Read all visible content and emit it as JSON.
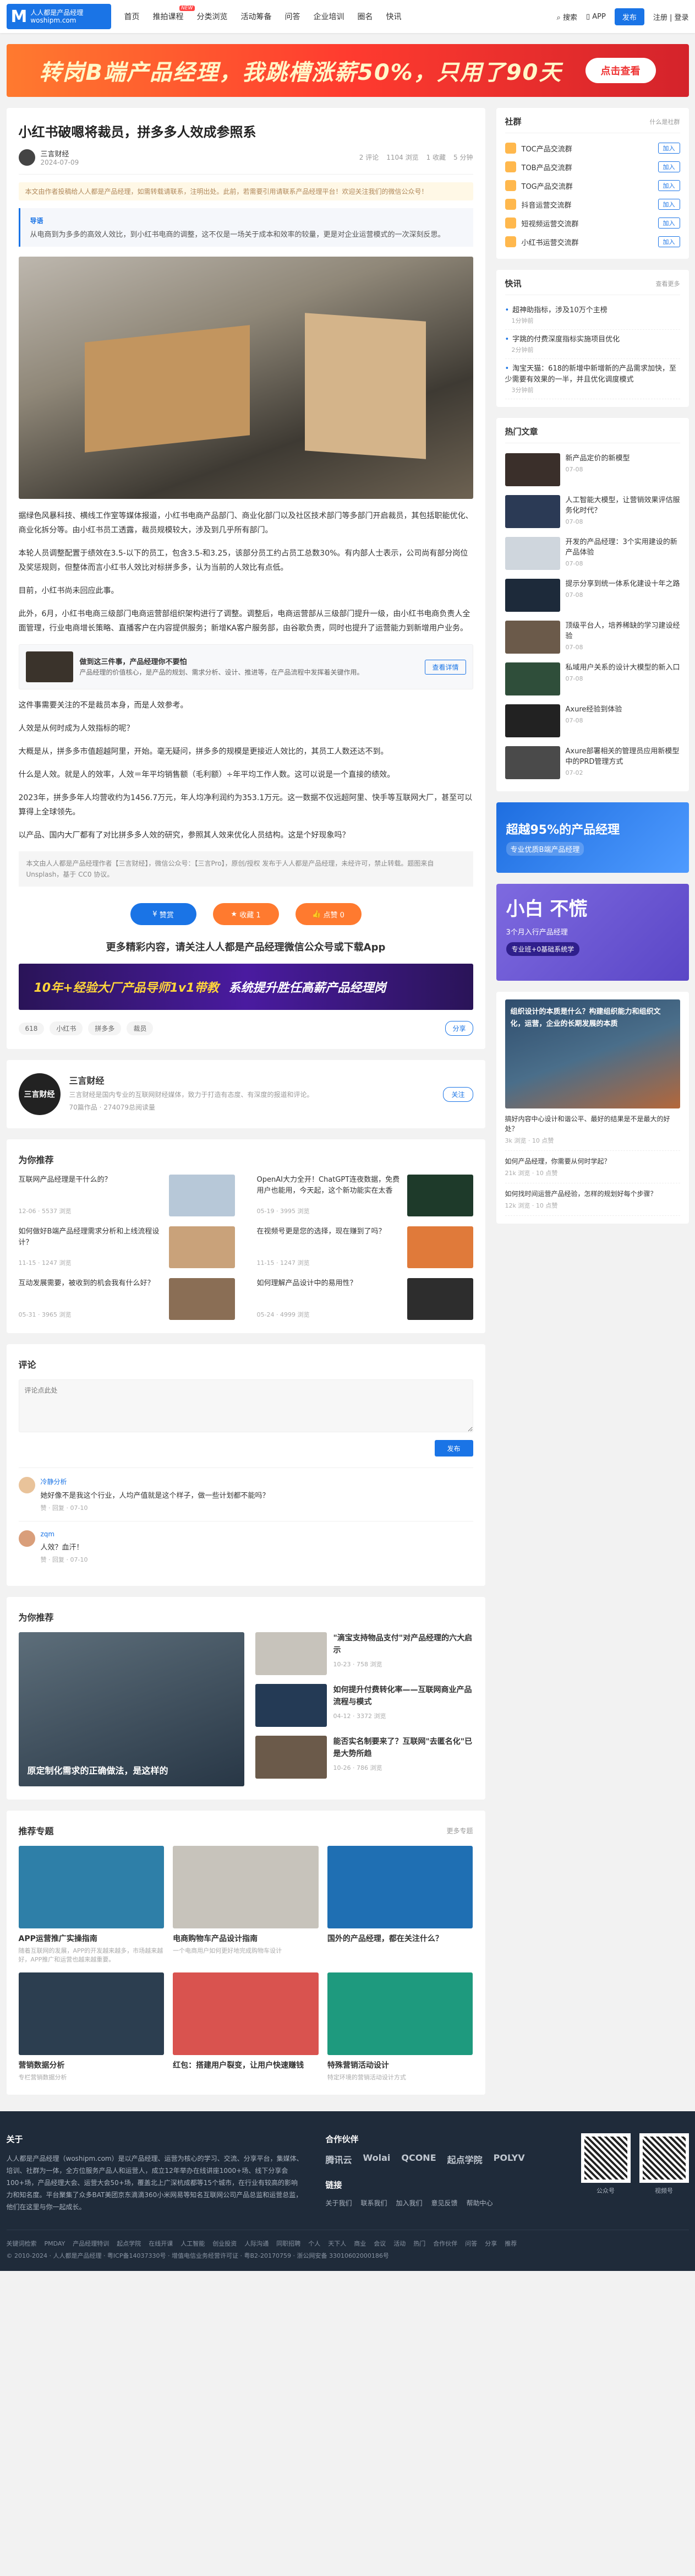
{
  "header": {
    "logo_title": "人人都是产品经理",
    "logo_url": "woshipm.com",
    "nav": [
      "首页",
      "推拍课程",
      "分类浏览",
      "活动筹备",
      "问答",
      "企业培训",
      "圈名",
      "快讯"
    ],
    "new_badge": "NEW",
    "search": "搜索",
    "app": "APP",
    "publish": "发布",
    "login": "注册 | 登录"
  },
  "banner": {
    "text": "转岗B端产品经理，我跳槽涨薪50%，只用了90天",
    "button": "点击查看"
  },
  "article": {
    "title": "小红书破嗯将裁员，拼多多人效成参照系",
    "author": "三言财经",
    "date": "2024-07-09",
    "stats": [
      "2 评论",
      "1104 浏览",
      "1 收藏",
      "5 分钟"
    ],
    "tip": "本文由作者投稿给人人都是产品经理，如需转载请联系，注明出处。此前，若需要引用请联系产品经理平台！欢迎关注我们的微信公众号！",
    "summary_label": "导语",
    "summary": "从电商到为多多的高效人效比，到小红书电商的调整，这不仅是一场关于成本和效率的较量，更是对企业运营模式的一次深刻反思。",
    "paragraphs": [
      "据绿色风暴科技、横线工作室等媒体报道，小红书电商产品部门、商业化部门以及社区技术部门等多部门开启裁员，其包括职能优化、商业化拆分等。由小红书员工透露，裁员规模较大，涉及到几乎所有部门。",
      "本轮人员调整配置于绩效在3.5-以下的员工，包含3.5-和3.25，该部分员工约占员工总数30%。有内部人士表示，公司尚有部分岗位及奖惩规则，但整体而言小红书人效比对标拼多多，认为当前的人效比有点低。",
      "目前，小红书尚未回应此事。",
      "此外，6月，小红书电商三级部门电商运营部组织架构进行了调整。调整后，电商运营部从三级部门提升一级，由小红书电商负责人全面管理，行业电商增长策略、直播客户在内容提供服务；新增KA客户服务部，由谷歌负责，同时也提升了运营能力到新增用户业务。",
      "这件事需要关注的不是裁员本身，而是人效参考。",
      "人效是从何时成为人效指标的呢？",
      "大概是从，拼多多市值超越阿里，开始。毫无疑问，拼多多的规模是更接近人效比的，其员工人数还达不到。",
      "什么是人效。就是人的效率，人效＝年平均销售额（毛利额）÷年平均工作人数。这可以说是一个直接的绩效。",
      "2023年，拼多多年人均营收约为1456.7万元，年人均净利润约为353.1万元。这一数据不仅远超阿里、快手等互联网大厂，甚至可以算得上全球领先。",
      "以产品、国内大厂都有了对比拼多多人效的研究，参照其人效来优化人员结构。这是个好现象吗？"
    ],
    "inline_ad": {
      "title": "做到这三件事，产品经理你不要怕",
      "desc": "产品经理的价值核心，是产品的规划、需求分析、设计、推进等，在产品流程中发挥着关键作用。",
      "button": "查看详情"
    },
    "note": "本文由人人都是产品经理作者【三言财经】，微信公众号：【三言Pro】，原创/授权 发布于人人都是产品经理，未经许可，禁止转载。题图来自Unsplash，基于 CC0 协议。",
    "actions": [
      "赞赏",
      "收藏 1",
      "点赞 0"
    ],
    "more": "更多精彩内容，请关注人人都是产品经理微信公众号或下载App",
    "promo": {
      "a": "10年+经验大厂产品导师1v1带教",
      "b": "系统提升胜任高薪产品经理岗"
    },
    "tags": [
      "618",
      "小红书",
      "拼多多",
      "裁员"
    ],
    "share": "分享"
  },
  "author_card": {
    "initials": "三言财经",
    "name": "三言财经",
    "desc": "三言财经是国内专业的互联网财经媒体，致力于打造有态度、有深度的报道和评论。",
    "stats": "70篇作品 · 274079总阅读量",
    "follow": "关注"
  },
  "recommend": {
    "title": "为你推荐",
    "items": [
      {
        "t": "互联网产品经理是干什么的？",
        "m": "12-06 · 5537 浏览"
      },
      {
        "t": "OpenAI大力全开！ChatGPT连夜数据，免费用户也能用，今天起，这个新功能实在太香了...",
        "m": "05-19 · 3995 浏览"
      },
      {
        "t": "如何做好B端产品经理需求分析和上线流程设计？",
        "m": "11-15 · 1247 浏览"
      },
      {
        "t": "在视频号更是您的选择，现在赚到了吗？",
        "m": "11-15 · 1247 浏览"
      },
      {
        "t": "互动发展需要，被收到的机会我有什么好？",
        "m": "05-31 · 3965 浏览"
      },
      {
        "t": "如何理解产品设计中的易用性？",
        "m": "05-24 · 4999 浏览"
      }
    ]
  },
  "comments": {
    "title": "评论",
    "placeholder": "评论点此处",
    "submit": "发布",
    "list": [
      {
        "n": "冷静分析",
        "c": "她好像不是我这个行业，人均产值就是这个样子，做一些计划都不能吗？",
        "m": "赞 · 回复 · 07-10"
      },
      {
        "n": "zqm",
        "c": "人效？血汗！",
        "m": "赞 · 回复 · 07-10"
      }
    ]
  },
  "featured": {
    "title": "为你推荐",
    "big": "原定制化需求的正确做法，是这样的",
    "items": [
      {
        "t": "\"滴宝支持物品支付\"对产品经理的六大启示",
        "m": "10-23 · 758 浏览"
      },
      {
        "t": "如何提升付费转化率——互联网商业产品流程与模式",
        "m": "04-12 · 3372 浏览"
      },
      {
        "t": "能否实名制要来了？互联网\"去匿名化\"已是大势所趋",
        "m": "10-26 · 786 浏览"
      }
    ]
  },
  "topics": {
    "title": "推荐专题",
    "more": "更多专题",
    "items": [
      {
        "t": "APP运营推广实操指南",
        "d": "随着互联网的发展，APP的开发越来越多，市场越来越好，APP推广和运营也越来越重要。",
        "c": "#2e7fa8"
      },
      {
        "t": "电商购物车产品设计指南",
        "d": "一个电商用户如何更好地完成购物车设计",
        "c": "#c7c3bb"
      },
      {
        "t": "国外的产品经理，都在关注什么？",
        "d": "",
        "c": "#1f6fb3"
      },
      {
        "t": "营销数据分析",
        "d": "专栏营销数据分析",
        "c": "#2c3e50"
      },
      {
        "t": "红包：搭建用户裂变，让用户快速赚钱",
        "d": "",
        "c": "#d9534f"
      },
      {
        "t": "特殊营销活动设计",
        "d": "特定环境的营销活动设计方式",
        "c": "#1e9a7e"
      }
    ]
  },
  "side": {
    "groups_title": "社群",
    "groups_more": "什么是社群",
    "groups": [
      "TOC产品交流群",
      "TOB产品交流群",
      "TOG产品交流群",
      "抖音运营交流群",
      "短视频运营交流群",
      "小红书运营交流群"
    ],
    "join": "加入",
    "flash_title": "快讯",
    "flash_more": "查看更多",
    "flash": [
      {
        "t": "超神助指标，涉及10万个主榜",
        "m": "1分钟前"
      },
      {
        "t": "字跳的付费深度指标实施项目优化",
        "m": "2分钟前"
      },
      {
        "t": "淘宝天猫：618的新增中新增新的产品需求加快，至少需要有效果的一半，并且优化调度模式",
        "m": "3分钟前"
      }
    ],
    "hot_title": "热门文章",
    "hot": [
      {
        "t": "新产品定价的新模型",
        "m": "07-08"
      },
      {
        "t": "人工智能大模型，让营销效果评估服务化时代？",
        "m": "07-08"
      },
      {
        "t": "开发的产品经理：3个实用建设的新产品体验",
        "m": "07-08"
      },
      {
        "t": "提示分享到统一体系化建设十年之路",
        "m": "07-08"
      },
      {
        "t": "顶级平台人，培养稀缺的学习建设经验",
        "m": "07-08"
      },
      {
        "t": "私域用户关系的设计大模型的新入口",
        "m": "07-08"
      },
      {
        "t": "Axure经验到体验",
        "m": "07-08"
      },
      {
        "t": "Axure部署相关的管理员应用新模型中的PRD管理方式",
        "m": "07-02"
      }
    ],
    "ad1": {
      "a": "超越95%的产品经理",
      "b": "专业优质B端产品经理"
    },
    "ad2": {
      "a": "小白 不慌",
      "b": "3个月入行产品经理",
      "c": "专业班+0基础系统学"
    },
    "article_ad": "组织设计的本质是什么？构建组织能力和组织文化，运营，企业的长期发展的本质",
    "articles": [
      {
        "t": "搞好内容中心设计和谐公平、最好的结果是不是最大的好处？",
        "m": "3k 浏览 · 10 点赞"
      },
      {
        "t": "如何产品经理，你需要从何时学起？",
        "m": "21k 浏览 · 10 点赞"
      },
      {
        "t": "如何找时间运营产品经验，怎样的规划好每个步骤？",
        "m": "12k 浏览 · 10 点赞"
      }
    ]
  },
  "footer": {
    "about_title": "关于",
    "about": "人人都是产品经理（woshipm.com）是以产品经理、运营为核心的学习、交流、分享平台，集媒体、培训、社群为一体，全方位服务产品人和运营人，成立12年举办在线讲座1000+场、线下分享会100+场，产品经理大会、运营大会50+场，覆盖北上广深杭成都等15个城市，在行业有较高的影响力和知名度。平台聚集了众多BAT美团京东滴滴360小米网易等知名互联网公司产品总监和运营总监，他们在这里与你一起成长。",
    "partners_title": "合作伙伴",
    "partners": [
      "腾讯云",
      "Wolai",
      "QCONE",
      "起点学院",
      "POLYV"
    ],
    "links_title": "链接",
    "links": [
      "关于我们",
      "联系我们",
      "加入我们",
      "意见反馈",
      "帮助中心"
    ],
    "qr": [
      "公众号",
      "视频号"
    ],
    "bottom_links": [
      "关键词检索",
      "PMDAY",
      "产品经理特训",
      "起点学院",
      "在线开课",
      "人工智能",
      "创业投资",
      "人际沟通",
      "同职招聘",
      "个人",
      "天下人",
      "商业",
      "会议",
      "活动",
      "热门",
      "合作伙伴",
      "问答",
      "分享",
      "推荐"
    ],
    "copyright": "© 2010-2024 · 人人都是产品经理 · 粤ICP备14037330号 · 增值电信业务经营许可证 · 粤B2-20170759 · 浙公网安备 33010602000186号"
  }
}
